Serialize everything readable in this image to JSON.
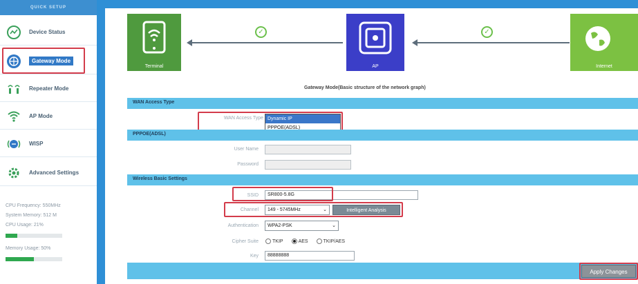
{
  "sidebar": {
    "header": "QUICK SETUP",
    "items": [
      {
        "label": "Device Status",
        "icon": "speedometer-icon"
      },
      {
        "label": "Gateway Mode",
        "icon": "globe-icon"
      },
      {
        "label": "Repeater Mode",
        "icon": "repeater-icon"
      },
      {
        "label": "AP Mode",
        "icon": "wifi-icon"
      },
      {
        "label": "WISP",
        "icon": "wisp-icon"
      },
      {
        "label": "Advanced Settings",
        "icon": "gear-icon"
      }
    ],
    "stats": {
      "cpu_freq": "CPU Frequency: 550MHz",
      "system_memory": "System Memory: 512 M",
      "cpu_usage": "CPU Usage: 21%",
      "cpu_usage_fraction": 0.21,
      "memory_usage": "Memory Usage: 50%",
      "memory_usage_fraction": 0.5
    }
  },
  "graph": {
    "terminal_label": "Terminal",
    "ap_label": "AP",
    "internet_label": "Internet",
    "title": "Gateway Mode(Basic structure of the network graph)"
  },
  "wan": {
    "section_title": "WAN Access Type",
    "label": "WAN Access Type",
    "options": [
      "Dynamic IP",
      "PPPOE(ADSL)"
    ],
    "selected": "Dynamic IP"
  },
  "pppoe": {
    "section_title": "PPPOE(ADSL)",
    "username_label": "User Name",
    "password_label": "Password"
  },
  "wireless": {
    "section_title": "Wireless Basic Settings",
    "ssid_label": "SSID",
    "ssid_value": "SR800-5.8G",
    "channel_label": "Channel",
    "channel_value": "149 - 5745MHz",
    "intelligent_button": "Intelligent Analysis",
    "auth_label": "Authentication",
    "auth_value": "WPA2-PSK",
    "cipher_label": "Cipher Suite",
    "cipher_options": [
      "TKIP",
      "AES",
      "TKIP/AES"
    ],
    "cipher_selected": "AES",
    "key_label": "Key",
    "key_value": "88888888"
  },
  "footer": {
    "apply_button": "Apply Changes"
  },
  "colors": {
    "accent_blue": "#2e8fd6",
    "section_bar": "#5fc1e9",
    "terminal_green": "#4f9a3e",
    "ap_blue": "#3b3ec8",
    "internet_green": "#7cc142",
    "highlight_red": "#d33b4a"
  }
}
